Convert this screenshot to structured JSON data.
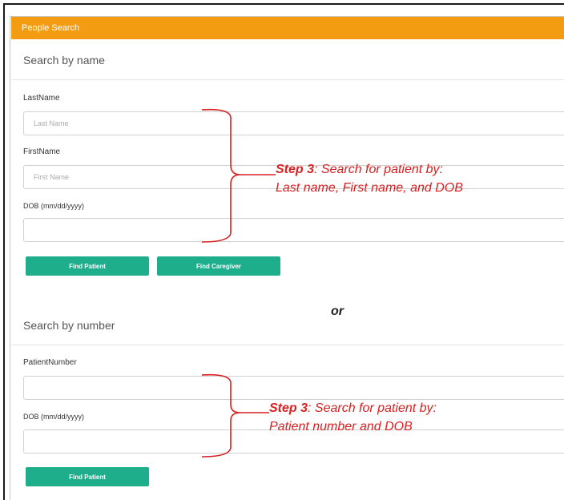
{
  "panel": {
    "title": "People Search"
  },
  "name_search": {
    "title": "Search by name",
    "last_name_label": "LastName",
    "last_name_placeholder": "Last Name",
    "first_name_label": "FirstName",
    "first_name_placeholder": "First Name",
    "dob_label": "DOB (mm/dd/yyyy)",
    "find_patient_label": "Find Patient",
    "find_caregiver_label": "Find Caregiver"
  },
  "separator": {
    "text": "or"
  },
  "number_search": {
    "title": "Search by number",
    "patient_number_label": "PatientNumber",
    "dob_label": "DOB (mm/dd/yyyy)",
    "find_patient_label": "Find Patient"
  },
  "annotations": {
    "name": {
      "step": "Step 3",
      "line1": ": Search for patient by:",
      "line2": "Last name, First name, and DOB"
    },
    "number": {
      "step": "Step 3",
      "line1": ": Search for patient by:",
      "line2": "Patient number and DOB"
    }
  },
  "colors": {
    "header": "#f39c12",
    "button": "#1fae8c",
    "annotation": "#d92020"
  }
}
